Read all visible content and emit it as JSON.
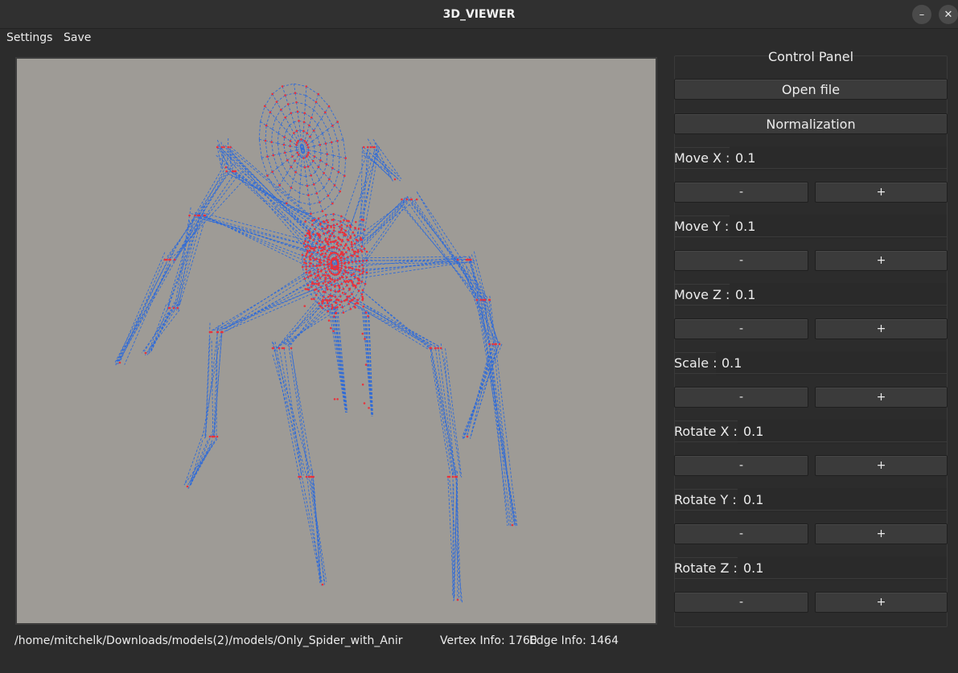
{
  "window": {
    "title": "3D_VIEWER"
  },
  "menu": {
    "settings": "Settings",
    "save": "Save"
  },
  "status": {
    "path": "/home/mitchelk/Downloads/models(2)/models/Only_Spider_with_Anir",
    "vertex": "Vertex Info: 1760",
    "edge": "Edge Info: 1464"
  },
  "panel": {
    "title": "Control Panel",
    "open_file": "Open file",
    "normalization": "Normalization",
    "minus": "-",
    "plus": "+",
    "controls": [
      {
        "label": "Move X :",
        "value": "0.1"
      },
      {
        "label": "Move Y :",
        "value": "0.1"
      },
      {
        "label": "Move Z :",
        "value": "0.1"
      },
      {
        "label": "Scale :",
        "value": "0.1"
      },
      {
        "label": "Rotate X :",
        "value": "0.1"
      },
      {
        "label": "Rotate Y :",
        "value": "0.1"
      },
      {
        "label": "Rotate Z :",
        "value": "0.1"
      }
    ]
  },
  "colors": {
    "viewport_bg": "#9e9b96",
    "edge_color": "#2f6bd8",
    "vertex_color": "#e8323c"
  }
}
